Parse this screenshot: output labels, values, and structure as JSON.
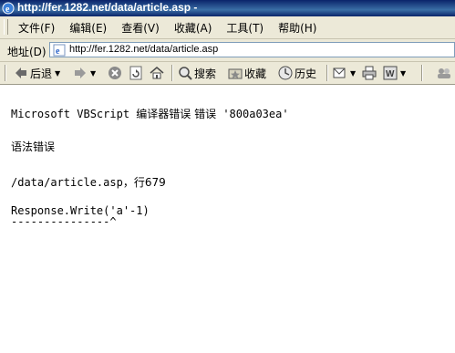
{
  "window": {
    "title": "http://fer.1282.net/data/article.asp -"
  },
  "menu": {
    "items": [
      "文件(F)",
      "编辑(E)",
      "查看(V)",
      "收藏(A)",
      "工具(T)",
      "帮助(H)"
    ]
  },
  "address": {
    "label": "地址(D)",
    "url": "http://fer.1282.net/data/article.asp"
  },
  "toolbar": {
    "back_label": "后退",
    "search_label": "搜索",
    "favorites_label": "收藏",
    "history_label": "历史"
  },
  "content": {
    "line1_prefix": "Microsoft VBScript ",
    "line1_cjk": "编译器错误 错误",
    "line1_code": " '800a03ea'",
    "line2": "语法错误",
    "line3_path": "/data/article.asp",
    "line3_cjk": "，行679",
    "line4": "Response.Write('a'-1)",
    "line5": "---------------^"
  }
}
